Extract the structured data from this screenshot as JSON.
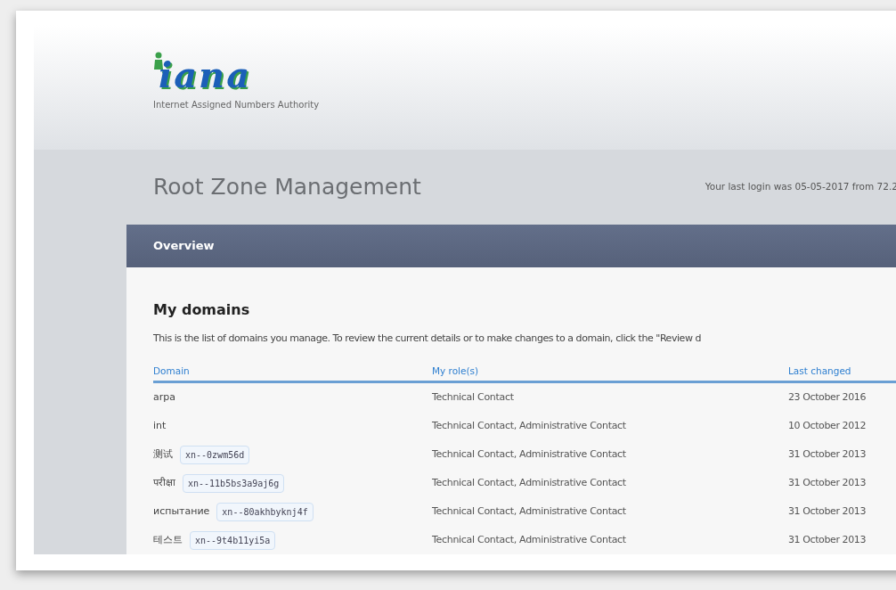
{
  "header": {
    "logo_text": "iana",
    "org_name": "Internet Assigned Numbers Authority"
  },
  "page": {
    "title": "Root Zone Management",
    "last_login": "Your last login was 05-05-2017 from 72.2"
  },
  "nav": {
    "tabs": [
      {
        "label": "Overview",
        "selected": true
      }
    ]
  },
  "domains": {
    "heading": "My domains",
    "description": "This is the list of domains you manage. To review the current details or to make changes to a domain, click the \"Review d",
    "columns": [
      "Domain",
      "My role(s)",
      "Last changed"
    ],
    "rows": [
      {
        "domain": "arpa",
        "role": "Technical Contact",
        "last_changed": "23 October 2016"
      },
      {
        "domain": "int",
        "role": "Technical Contact, Administrative Contact",
        "last_changed": "10 October 2012"
      },
      {
        "domain": "测试",
        "punycode": "xn--0zwm56d",
        "role": "Technical Contact, Administrative Contact",
        "last_changed": "31 October 2013"
      },
      {
        "domain": "परीक्षा",
        "punycode": "xn--11b5bs3a9aj6g",
        "role": "Technical Contact, Administrative Contact",
        "last_changed": "31 October 2013"
      },
      {
        "domain": "испытание",
        "punycode": "xn--80akhbyknj4f",
        "role": "Technical Contact, Administrative Contact",
        "last_changed": "31 October 2013"
      },
      {
        "domain": "테스트",
        "punycode": "xn--9t4b11yi5a",
        "role": "Technical Contact, Administrative Contact",
        "last_changed": "31 October 2013"
      }
    ]
  }
}
